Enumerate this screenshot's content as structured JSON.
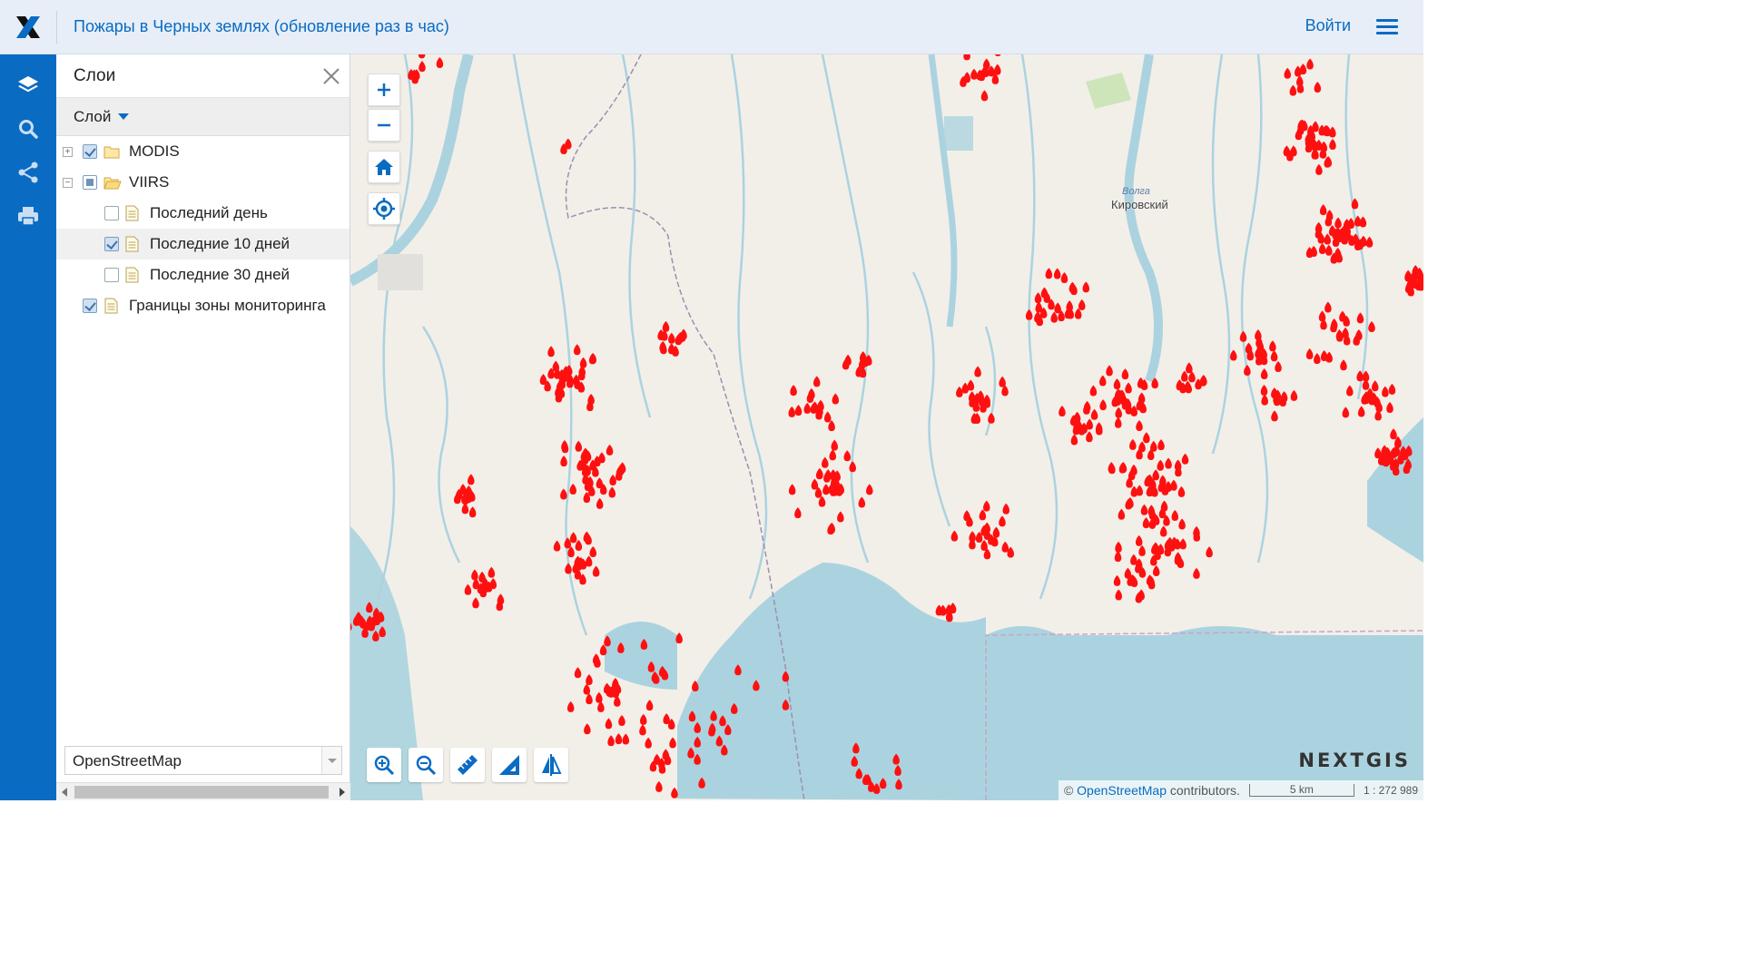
{
  "header": {
    "title": "Пожары в Черных землях (обновление раз в час)",
    "login_label": "Войти"
  },
  "toolbar": {
    "items": [
      "layers-icon",
      "search-icon",
      "share-icon",
      "print-icon"
    ]
  },
  "panel": {
    "title": "Слои",
    "column_header": "Слой",
    "layers": [
      {
        "label": "MODIS",
        "checked": true,
        "type": "folder",
        "expanded": false
      },
      {
        "label": "VIIRS",
        "checked": "partial",
        "type": "folder",
        "expanded": true
      },
      {
        "label": "Последний день",
        "checked": false,
        "type": "layer"
      },
      {
        "label": "Последние 10 дней",
        "checked": true,
        "type": "layer",
        "selected": true
      },
      {
        "label": "Последние 30 дней",
        "checked": false,
        "type": "layer"
      },
      {
        "label": "Границы зоны мониторинга",
        "checked": true,
        "type": "layer"
      }
    ],
    "basemap": "OpenStreetMap"
  },
  "map": {
    "city_label": "Кировский",
    "river_label": "Волга",
    "brand": "NEXTGIS",
    "attribution_prefix": "©",
    "attribution_link": "OpenStreetMap",
    "attribution_suffix": "contributors.",
    "scale_label": "5 km",
    "scale_ratio": "1 : 272 989",
    "colors": {
      "fire": "#ff1010",
      "water": "#abd3df",
      "land": "#f2efe9",
      "accent": "#0a6bc2"
    }
  }
}
